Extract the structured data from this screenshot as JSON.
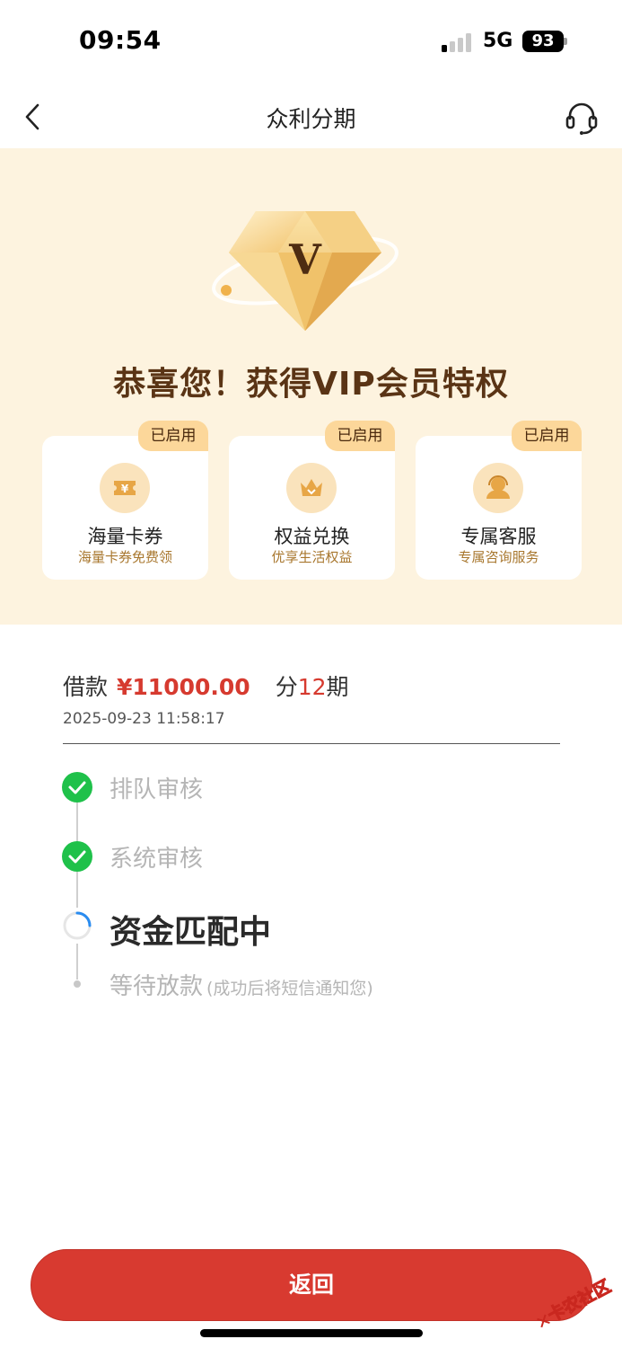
{
  "status_bar": {
    "time": "09:54",
    "network": "5G",
    "battery": "93"
  },
  "nav": {
    "title": "众利分期"
  },
  "vip": {
    "headline": "恭喜您！获得VIP会员特权",
    "diamond_letter": "V",
    "cards": [
      {
        "badge": "已启用",
        "title": "海量卡券",
        "subtitle": "海量卡券免费领",
        "icon": "coupon-icon"
      },
      {
        "badge": "已启用",
        "title": "权益兑换",
        "subtitle": "优享生活权益",
        "icon": "crown-icon"
      },
      {
        "badge": "已启用",
        "title": "专属客服",
        "subtitle": "专属咨询服务",
        "icon": "agent-icon"
      }
    ]
  },
  "loan": {
    "label": "借款",
    "amount": "¥11000.00",
    "period_prefix": "分",
    "period_count": "12",
    "period_suffix": "期",
    "datetime": "2025-09-23 11:58:17"
  },
  "steps": [
    {
      "label": "排队审核",
      "state": "done"
    },
    {
      "label": "系统审核",
      "state": "done"
    },
    {
      "label": "资金匹配中",
      "state": "active"
    },
    {
      "label": "等待放款",
      "note": "(成功后将短信通知您)",
      "state": "pending"
    }
  ],
  "footer": {
    "return_label": "返回",
    "watermark": "卡农社区"
  },
  "colors": {
    "accent": "#d83a30",
    "success": "#1fc14a",
    "banner_bg": "#fdf3df",
    "badge_bg": "#fcd79a"
  }
}
